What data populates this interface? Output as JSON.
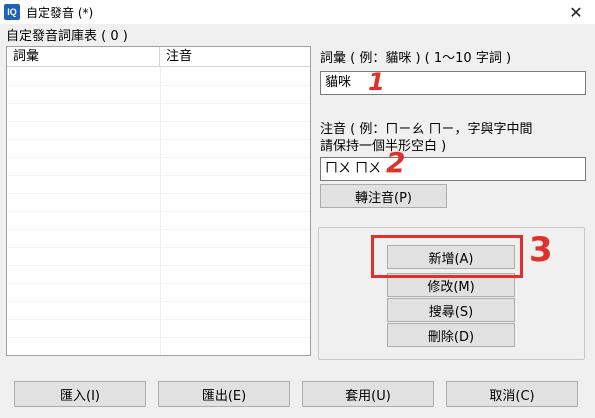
{
  "window": {
    "title": "自定發音 (*)",
    "icon_text": "IQ",
    "close_glyph": "✕"
  },
  "list": {
    "title": "自定發音詞庫表 ( 0 )",
    "columns": [
      "詞彙",
      "注音"
    ]
  },
  "word_field": {
    "label": "詞彙 ( 例：貓咪 ) ( 1～10 字詞 )",
    "value": "貓咪"
  },
  "zhuyin_field": {
    "label_line1": "注音 ( 例：ㄇㄧㄠ ㄇㄧ，字與字中間",
    "label_line2": "請保持一個半形空白 )",
    "value": "ㄇㄨ ㄇㄨ"
  },
  "buttons": {
    "convert": "轉注音(P)",
    "add": "新增(A)",
    "modify": "修改(M)",
    "search": "搜尋(S)",
    "delete": "刪除(D)",
    "import": "匯入(I)",
    "export": "匯出(E)",
    "apply": "套用(U)",
    "cancel": "取消(C)"
  },
  "annotations": {
    "step1": "1",
    "step2": "2",
    "step3": "3",
    "color": "#e0302a"
  }
}
